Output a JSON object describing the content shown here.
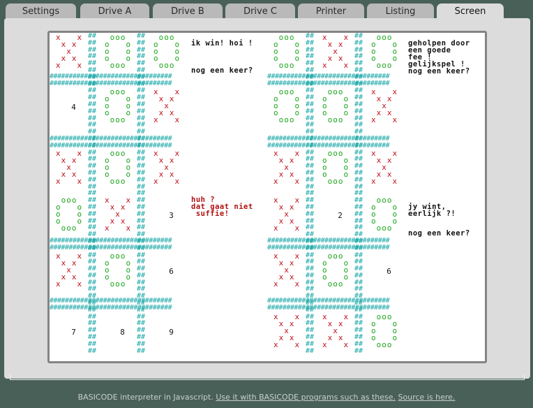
{
  "tabs": [
    {
      "label": "Settings",
      "active": false
    },
    {
      "label": "Drive A",
      "active": false
    },
    {
      "label": "Drive B",
      "active": false
    },
    {
      "label": "Drive C",
      "active": false
    },
    {
      "label": "Printer",
      "active": false
    },
    {
      "label": "Listing",
      "active": false
    },
    {
      "label": "Screen",
      "active": true
    }
  ],
  "screen": {
    "colors": {
      "x": "#c0101a",
      "o": "#1aa51a",
      "grid": "#18a6a6",
      "text": "#111111",
      "highlight": "#b01010"
    },
    "left_board": [
      [
        "X",
        "O",
        "O"
      ],
      [
        "4",
        "O",
        "X"
      ],
      [
        "X",
        "O",
        "X"
      ],
      [
        "O",
        "X",
        "3"
      ],
      [
        "X",
        "O",
        "6"
      ],
      [
        "7",
        "8",
        "9"
      ]
    ],
    "right_board": [
      [
        "O",
        "X",
        "O"
      ],
      [
        "O",
        "O",
        "X"
      ],
      [
        "X",
        "O",
        "X"
      ],
      [
        "X",
        "2",
        "O"
      ],
      [
        "X",
        "O",
        "6"
      ],
      [
        "X",
        "X",
        "O"
      ]
    ],
    "messages_left": {
      "win": "ik win! hoi !",
      "again": "nog een keer?",
      "huh": "huh ?\ndat gaat niet\n suffie!"
    },
    "messages_right": {
      "helped": "geholpen door\neen goede\nfee !\ngelijkspel !\nnog een keer?",
      "won": "jy wint,\neerlijk ?!",
      "again": "nog een keer?"
    }
  },
  "footer": {
    "text": "BASICODE interpreter in Javascript.",
    "link1": "Use it with BASICODE programs such as these.",
    "link2": "Source is here."
  }
}
